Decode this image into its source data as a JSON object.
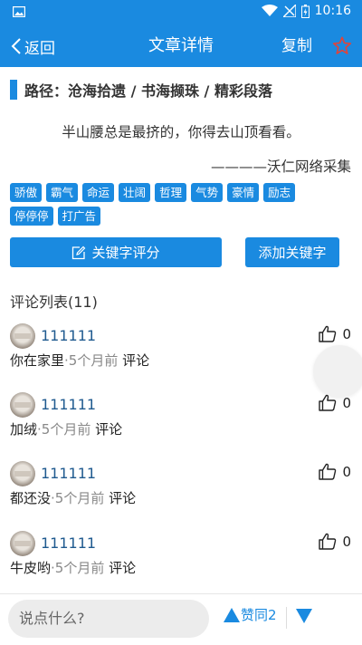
{
  "status_bar": {
    "time": "10:16",
    "icons": [
      "image-icon",
      "wifi-icon",
      "signal-icon",
      "battery-icon"
    ]
  },
  "header": {
    "back_label": "返回",
    "title": "文章详情",
    "copy_label": "复制"
  },
  "path": {
    "text": "路径：沧海拾遗 / 书海撷珠 / 精彩段落"
  },
  "article": {
    "quote": "半山腰总是最挤的，你得去山顶看看。",
    "author": "————沃仁网络采集"
  },
  "tags": [
    "骄傲",
    "霸气",
    "命运",
    "壮阔",
    "哲理",
    "气势",
    "豪情",
    "励志",
    "停停停",
    "打广告"
  ],
  "buttons": {
    "rate": "关键字评分",
    "add": "添加关键字"
  },
  "comments_title": "评论列表(11)",
  "comments": [
    {
      "user": "111111",
      "likes": "0",
      "text": "你在家里",
      "time": "·5个月前",
      "action": "评论"
    },
    {
      "user": "111111",
      "likes": "0",
      "text": "加绒",
      "time": "·5个月前",
      "action": "评论"
    },
    {
      "user": "111111",
      "likes": "0",
      "text": "都还没",
      "time": "·5个月前",
      "action": "评论"
    },
    {
      "user": "111111",
      "likes": "0",
      "text": "牛皮哟",
      "time": "·5个月前",
      "action": "评论"
    }
  ],
  "bottom": {
    "placeholder": "说点什么?",
    "upvote_label": "赞同2"
  },
  "colors": {
    "primary": "#1a8ae0",
    "star": "#e0443a",
    "username": "#1f5a8f"
  }
}
